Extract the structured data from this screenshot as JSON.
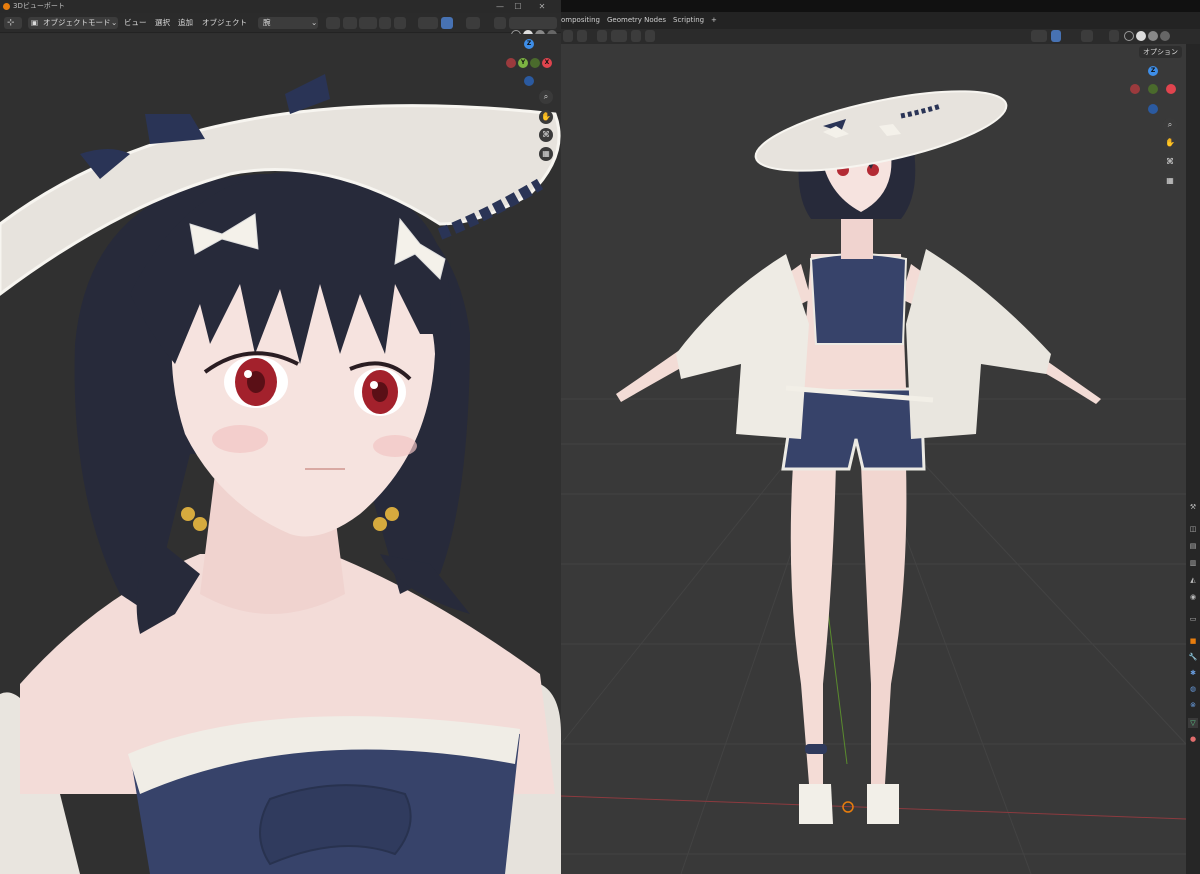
{
  "left_window": {
    "title": "3Dビューポート",
    "header": {
      "mode_label": "オブジェクトモード",
      "menu_view": "ビュー",
      "menu_select": "選択",
      "menu_add": "追加",
      "menu_object": "オブジェクト",
      "transform_pivot": "腕"
    },
    "gizmo": {
      "z": "Z",
      "y": "Y",
      "x": "X"
    }
  },
  "right_window": {
    "tabs": [
      "ompositing",
      "Geometry Nodes",
      "Scripting"
    ],
    "add_tab": "+",
    "options_label": "オプション",
    "gizmo": {
      "z": "Z"
    }
  },
  "colors": {
    "accent": "#4772b3",
    "x_axis": "#e0444e",
    "y_axis": "#7cb342",
    "z_axis": "#3e8ee8",
    "blender_orange": "#e87d0d"
  }
}
